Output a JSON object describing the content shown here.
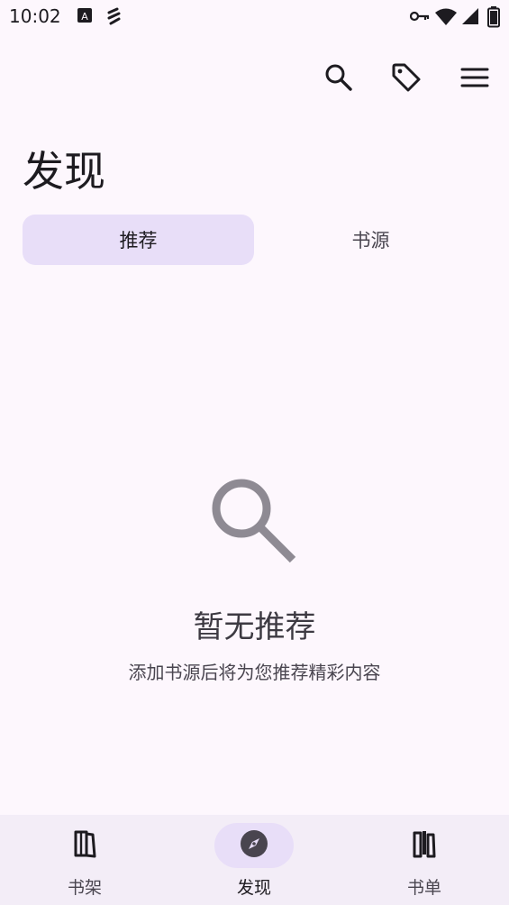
{
  "status_bar": {
    "time": "10:02",
    "notification_icons": [
      "a-badge-icon",
      "signal-app-icon"
    ],
    "system_icons": [
      "vpn-key-icon",
      "wifi-icon",
      "cell-signal-icon",
      "battery-icon"
    ]
  },
  "top_actions": {
    "search_icon": "search-icon",
    "tag_icon": "tag-icon",
    "menu_icon": "menu-icon"
  },
  "header": {
    "title": "发现"
  },
  "tabs": [
    {
      "label": "推荐",
      "active": true
    },
    {
      "label": "书源",
      "active": false
    }
  ],
  "empty_state": {
    "icon": "search-icon",
    "title": "暂无推荐",
    "subtitle": "添加书源后将为您推荐精彩内容"
  },
  "bottom_nav": [
    {
      "label": "书架",
      "icon": "book-icon",
      "active": false
    },
    {
      "label": "发现",
      "icon": "compass-icon",
      "active": true
    },
    {
      "label": "书单",
      "icon": "book-list-icon",
      "active": false
    }
  ],
  "colors": {
    "background": "#FDF7FD",
    "accent_container": "#E8DEF8",
    "nav_background": "#F3EDF7",
    "text_primary": "#1D1B20",
    "text_secondary": "#49454F"
  }
}
